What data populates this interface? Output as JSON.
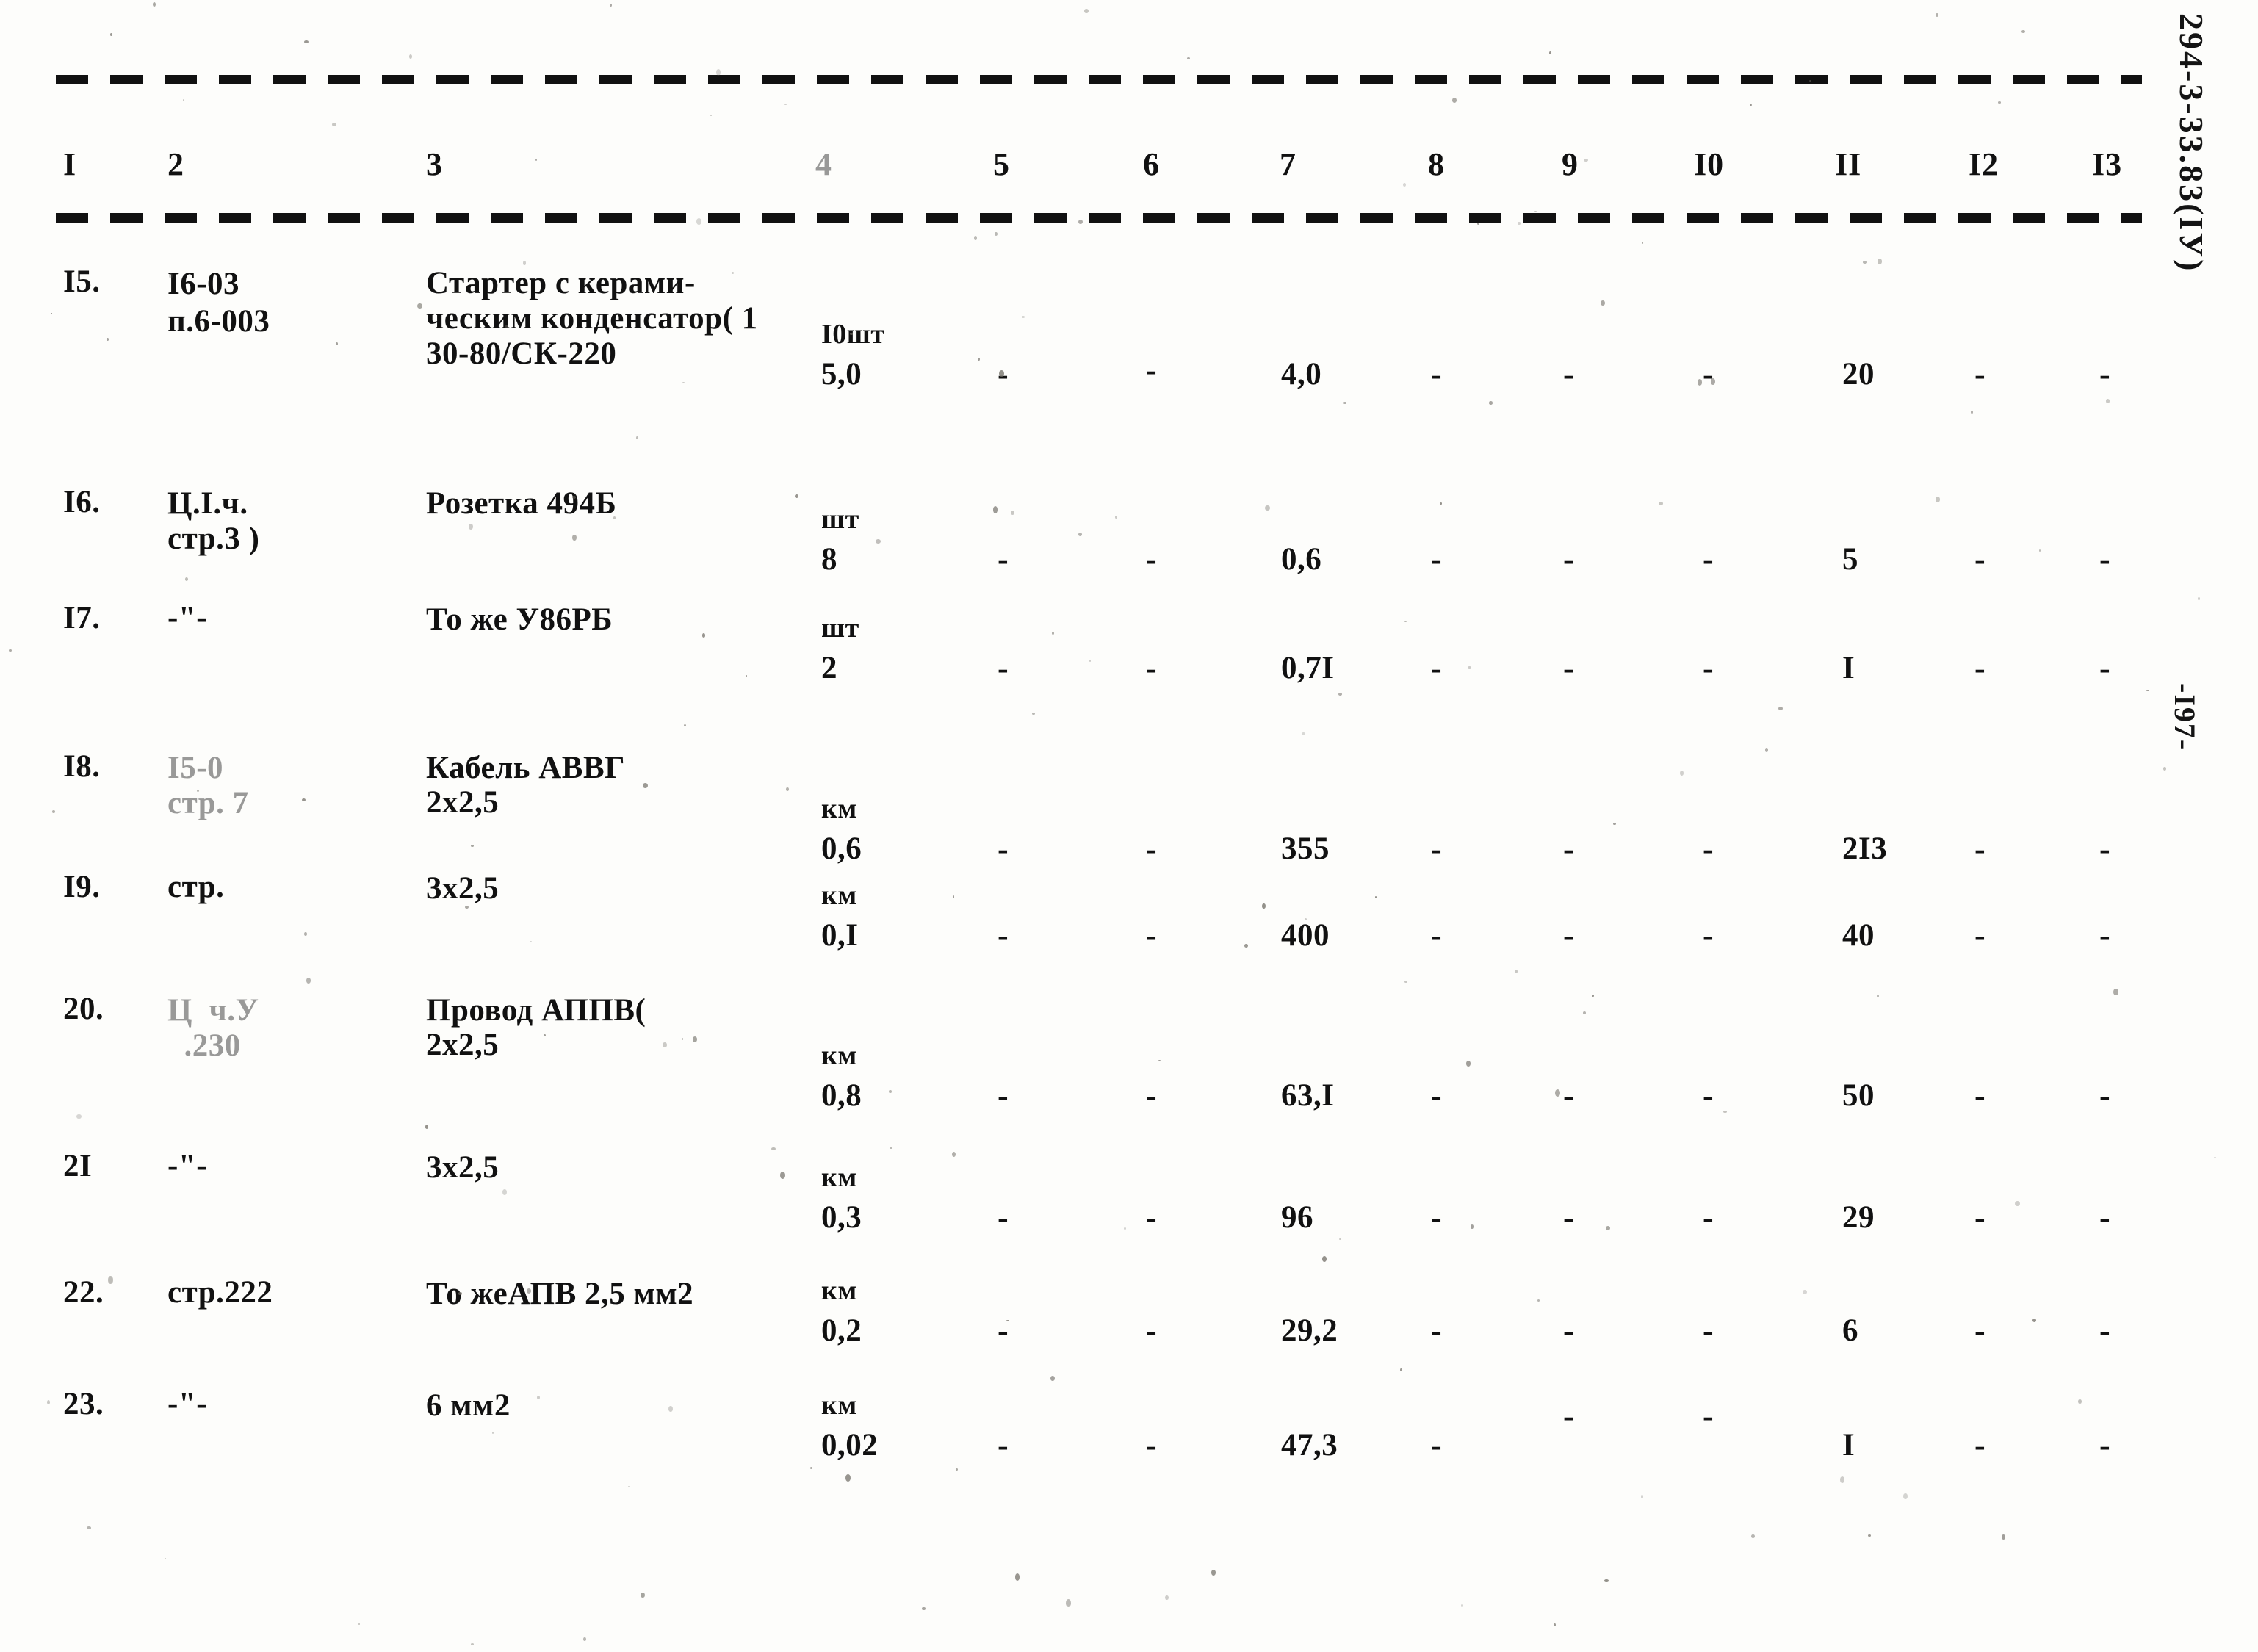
{
  "document": {
    "code_vertical": "294-3-33.83(IУ)",
    "page_number_vertical": "-I97-"
  },
  "table": {
    "column_headers": [
      "I",
      "2",
      "3",
      "4",
      "5",
      "6",
      "7",
      "8",
      "9",
      "I0",
      "II",
      "I2",
      "I3"
    ],
    "dash_symbol": "-",
    "ditto_symbol": "-\"-",
    "rows": [
      {
        "num": "I5.",
        "ref": "I6-03\nп.6-003",
        "name": "Стартер с керами-\nческим конденсатор( 1\n30-80/СК-220",
        "unit": "I0шт",
        "qty": "5,0",
        "c5": "-",
        "c6": "-",
        "c7": "4,0",
        "c8": "-",
        "c9": "-",
        "c10": "-",
        "c11": "20",
        "c12": "-",
        "c13": "-"
      },
      {
        "num": "I6.",
        "ref": "Ц.I.ч.\nстр.3 )",
        "name": "Розетка 494Б",
        "unit": "шт",
        "qty": "8",
        "c5": "-",
        "c6": "-",
        "c7": "0,6",
        "c8": "-",
        "c9": "-",
        "c10": "-",
        "c11": "5",
        "c12": "-",
        "c13": "-"
      },
      {
        "num": "I7.",
        "ref": "-\"-",
        "name": "То же У86РБ",
        "unit": "шт",
        "qty": "2",
        "c5": "-",
        "c6": "-",
        "c7": "0,7I",
        "c8": "-",
        "c9": "-",
        "c10": "-",
        "c11": "I",
        "c12": "-",
        "c13": "-"
      },
      {
        "num": "I8.",
        "ref": "I5-0\nстр. 7",
        "name": "Кабель АВВГ\n2х2,5",
        "unit": "км",
        "qty": "0,6",
        "c5": "-",
        "c6": "-",
        "c7": "355",
        "c8": "-",
        "c9": "-",
        "c10": "-",
        "c11": "2I3",
        "c12": "-",
        "c13": "-"
      },
      {
        "num": "I9.",
        "ref": "стр.",
        "name": "3х2,5",
        "unit": "км",
        "qty": "0,I",
        "c5": "-",
        "c6": "-",
        "c7": "400",
        "c8": "-",
        "c9": "-",
        "c10": "-",
        "c11": "40",
        "c12": "-",
        "c13": "-"
      },
      {
        "num": "20.",
        "ref": "Ц  ч.У\n  .230",
        "name": "Провод АППВ(\n2х2,5",
        "unit": "км",
        "qty": "0,8",
        "c5": "-",
        "c6": "-",
        "c7": "63,I",
        "c8": "-",
        "c9": "-",
        "c10": "-",
        "c11": "50",
        "c12": "-",
        "c13": "-"
      },
      {
        "num": "2I",
        "ref": "-\"-",
        "name": "3х2,5",
        "unit": "км",
        "qty": "0,3",
        "c5": "-",
        "c6": "-",
        "c7": "96",
        "c8": "-",
        "c9": "-",
        "c10": "-",
        "c11": "29",
        "c12": "-",
        "c13": "-"
      },
      {
        "num": "22.",
        "ref": "стр.222",
        "name": "То жеАПВ 2,5 мм2",
        "unit": "км",
        "qty": "0,2",
        "c5": "-",
        "c6": "-",
        "c7": "29,2",
        "c8": "-",
        "c9": "-",
        "c10": "-",
        "c11": "6",
        "c12": "-",
        "c13": "-"
      },
      {
        "num": "23.",
        "ref": "-\"-",
        "name": "6 мм2",
        "unit": "км",
        "qty": "0,02",
        "c5": "-",
        "c6": "-",
        "c7": "47,3",
        "c8": "-",
        "c9": "-",
        "c10": "-",
        "c11": "I",
        "c12": "-",
        "c13": "-"
      }
    ]
  }
}
